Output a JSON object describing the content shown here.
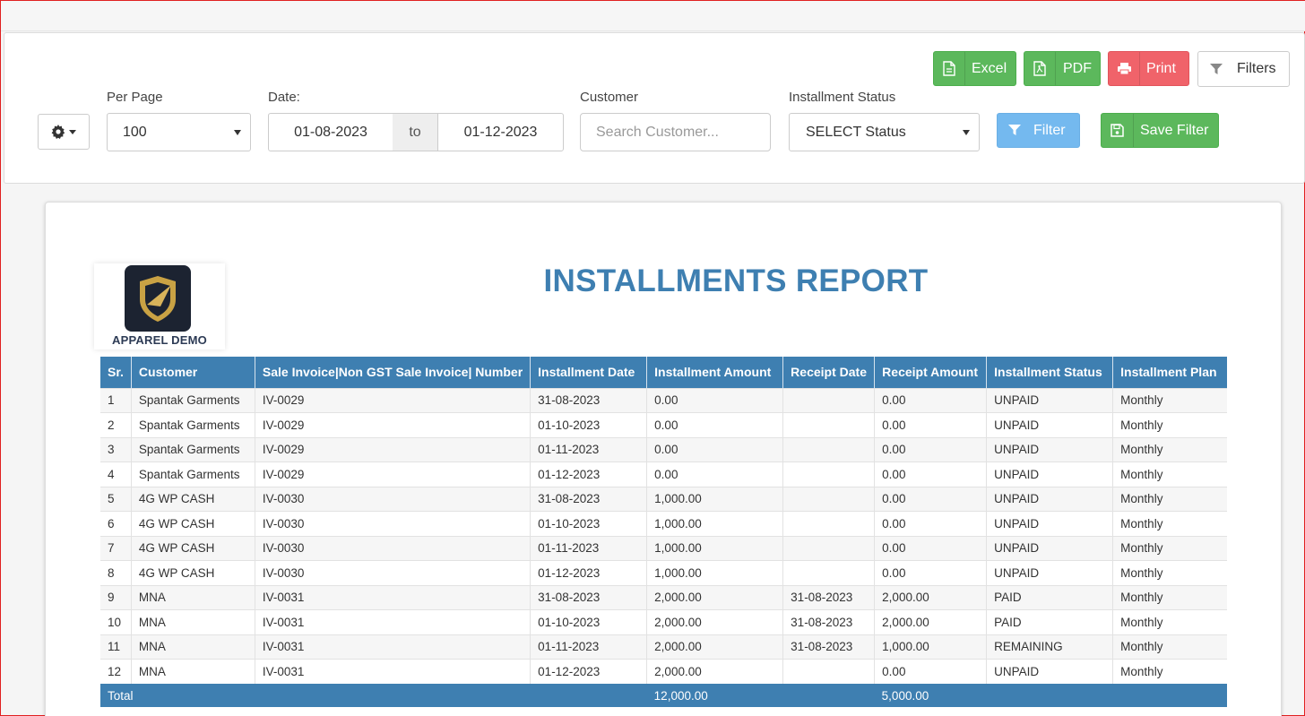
{
  "toolbar": {
    "excel_label": "Excel",
    "pdf_label": "PDF",
    "print_label": "Print",
    "filters_label": "Filters",
    "filter_label": "Filter",
    "save_filter_label": "Save Filter"
  },
  "filters": {
    "per_page_label": "Per Page",
    "per_page_value": "100",
    "date_label": "Date:",
    "date_from": "01-08-2023",
    "date_to_sep": "to",
    "date_to": "01-12-2023",
    "customer_label": "Customer",
    "customer_placeholder": "Search Customer...",
    "status_label": "Installment Status",
    "status_value": "SELECT Status"
  },
  "report": {
    "logo_text": "APPAREL DEMO",
    "title": "INSTALLMENTS REPORT",
    "columns": [
      "Sr.",
      "Customer",
      "Sale Invoice|Non GST Sale Invoice| Number",
      "Installment Date",
      "Installment Amount",
      "Receipt Date",
      "Receipt Amount",
      "Installment Status",
      "Installment Plan"
    ],
    "rows": [
      [
        "1",
        "Spantak Garments",
        "IV-0029",
        "31-08-2023",
        "0.00",
        "",
        "0.00",
        "UNPAID",
        "Monthly"
      ],
      [
        "2",
        "Spantak Garments",
        "IV-0029",
        "01-10-2023",
        "0.00",
        "",
        "0.00",
        "UNPAID",
        "Monthly"
      ],
      [
        "3",
        "Spantak Garments",
        "IV-0029",
        "01-11-2023",
        "0.00",
        "",
        "0.00",
        "UNPAID",
        "Monthly"
      ],
      [
        "4",
        "Spantak Garments",
        "IV-0029",
        "01-12-2023",
        "0.00",
        "",
        "0.00",
        "UNPAID",
        "Monthly"
      ],
      [
        "5",
        "4G WP CASH",
        "IV-0030",
        "31-08-2023",
        "1,000.00",
        "",
        "0.00",
        "UNPAID",
        "Monthly"
      ],
      [
        "6",
        "4G WP CASH",
        "IV-0030",
        "01-10-2023",
        "1,000.00",
        "",
        "0.00",
        "UNPAID",
        "Monthly"
      ],
      [
        "7",
        "4G WP CASH",
        "IV-0030",
        "01-11-2023",
        "1,000.00",
        "",
        "0.00",
        "UNPAID",
        "Monthly"
      ],
      [
        "8",
        "4G WP CASH",
        "IV-0030",
        "01-12-2023",
        "1,000.00",
        "",
        "0.00",
        "UNPAID",
        "Monthly"
      ],
      [
        "9",
        "MNA",
        "IV-0031",
        "31-08-2023",
        "2,000.00",
        "31-08-2023",
        "2,000.00",
        "PAID",
        "Monthly"
      ],
      [
        "10",
        "MNA",
        "IV-0031",
        "01-10-2023",
        "2,000.00",
        "31-08-2023",
        "2,000.00",
        "PAID",
        "Monthly"
      ],
      [
        "11",
        "MNA",
        "IV-0031",
        "01-11-2023",
        "2,000.00",
        "31-08-2023",
        "1,000.00",
        "REMAINING",
        "Monthly"
      ],
      [
        "12",
        "MNA",
        "IV-0031",
        "01-12-2023",
        "2,000.00",
        "",
        "0.00",
        "UNPAID",
        "Monthly"
      ]
    ],
    "total": {
      "label": "Total",
      "installment_amount": "12,000.00",
      "receipt_amount": "5,000.00"
    }
  },
  "colors": {
    "header_blue": "#3e7fb1",
    "success_green": "#5cb85c",
    "danger_red": "#f0636a",
    "info_blue": "#74b9ef"
  },
  "icons": [
    "gear-icon",
    "file-excel-icon",
    "file-pdf-icon",
    "printer-icon",
    "funnel-icon",
    "floppy-disk-icon",
    "shield-logo-icon"
  ]
}
